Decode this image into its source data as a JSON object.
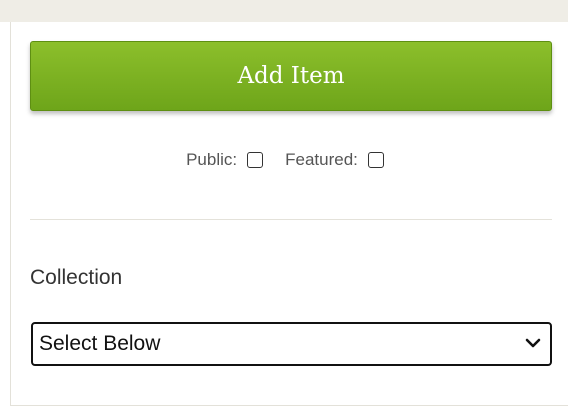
{
  "form": {
    "add_item_label": "Add Item",
    "public_label": "Public:",
    "featured_label": "Featured:",
    "public_checked": false,
    "featured_checked": false,
    "collection_heading": "Collection",
    "collection_selected": "Select Below"
  },
  "colors": {
    "button_green": "#7ab322",
    "top_band": "#efede6"
  },
  "icons": {
    "select_arrow": "chevron-down-icon"
  }
}
